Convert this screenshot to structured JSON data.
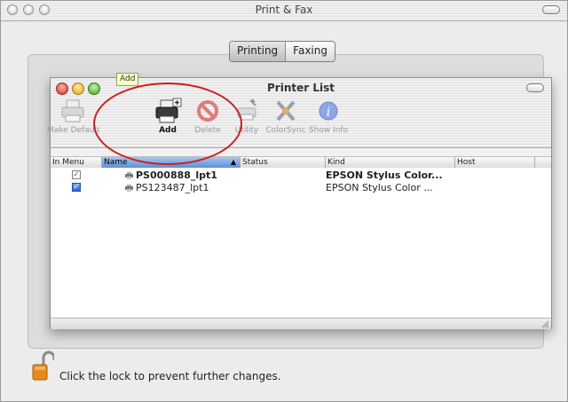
{
  "window": {
    "title": "Print & Fax"
  },
  "tabs": [
    {
      "label": "Printing",
      "selected": true
    },
    {
      "label": "Faxing",
      "selected": false
    }
  ],
  "printer_list": {
    "title": "Printer List",
    "toolbar": [
      {
        "label": "Make Default",
        "icon": "printer-icon",
        "enabled": false
      },
      {
        "label": "Add",
        "icon": "add-printer-icon",
        "enabled": true
      },
      {
        "label": "Delete",
        "icon": "delete-icon",
        "enabled": false
      },
      {
        "label": "Utility",
        "icon": "utility-icon",
        "enabled": false
      },
      {
        "label": "ColorSync",
        "icon": "colorsync-icon",
        "enabled": false
      },
      {
        "label": "Show Info",
        "icon": "info-icon",
        "enabled": false
      }
    ],
    "tooltip": "Add",
    "columns": [
      "In Menu",
      "Name",
      "Status",
      "Kind",
      "Host"
    ],
    "sorted_column": "Name",
    "rows": [
      {
        "in_menu": "✓",
        "checked": false,
        "name": "PS000888_lpt1",
        "status": "",
        "kind": "EPSON Stylus Color...",
        "host": "",
        "bold": true
      },
      {
        "in_menu": "✓",
        "checked": true,
        "name": "PS123487_lpt1",
        "status": "",
        "kind": "EPSON Stylus Color ...",
        "host": "",
        "bold": false
      }
    ]
  },
  "footer": {
    "lock_text": "Click the lock to prevent further changes."
  },
  "colors": {
    "annotation": "#cc2020",
    "selection": "#5d8fd6",
    "tooltip_bg": "#ffffc8"
  }
}
